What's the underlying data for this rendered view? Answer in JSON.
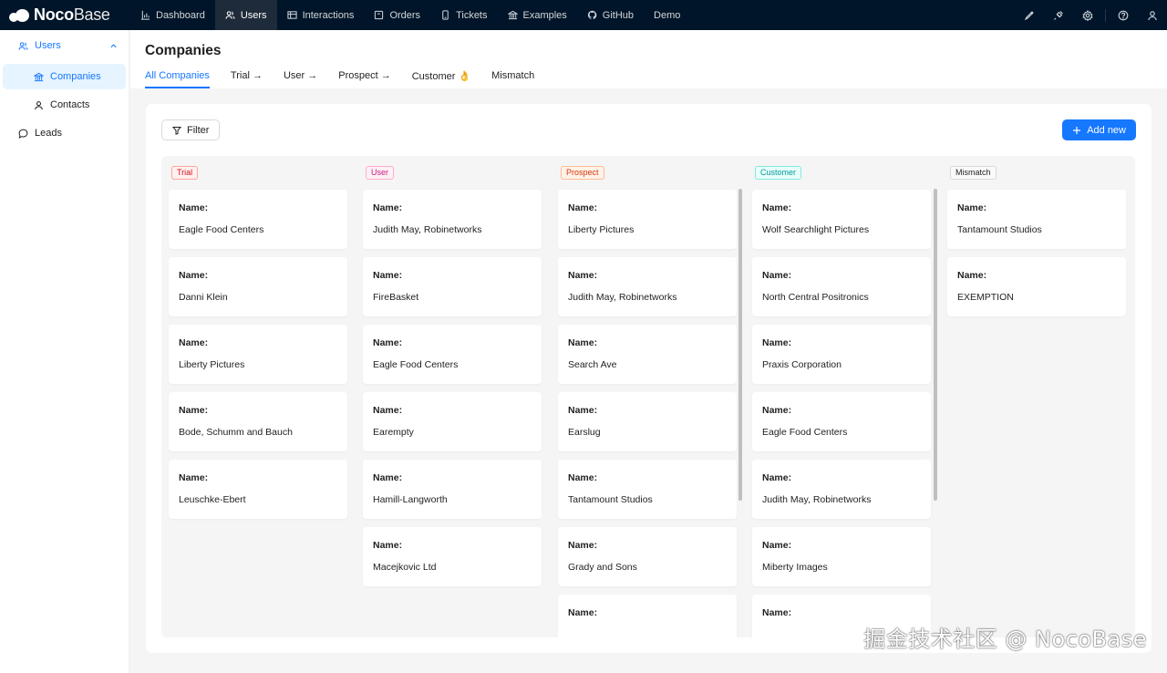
{
  "brand": {
    "name_bold": "Noco",
    "name_light": "Base"
  },
  "topnav": {
    "items": [
      {
        "label": "Dashboard",
        "icon": "bar-chart-icon"
      },
      {
        "label": "Users",
        "icon": "users-icon"
      },
      {
        "label": "Interactions",
        "icon": "table-icon"
      },
      {
        "label": "Orders",
        "icon": "box-icon"
      },
      {
        "label": "Tickets",
        "icon": "ticket-icon"
      },
      {
        "label": "Examples",
        "icon": "bank-icon"
      },
      {
        "label": "GitHub",
        "icon": "github-icon"
      },
      {
        "label": "Demo",
        "icon": ""
      }
    ],
    "active_index": 1,
    "right_icons": [
      "highlighter-icon",
      "plugin-icon",
      "settings-icon",
      "help-icon",
      "user-icon"
    ]
  },
  "sidebar": {
    "group_label": "Users",
    "items": [
      {
        "label": "Companies",
        "active": true
      },
      {
        "label": "Contacts",
        "active": false
      }
    ],
    "leads_label": "Leads"
  },
  "page": {
    "title": "Companies",
    "tabs": [
      "All Companies",
      "Trial →",
      "User →",
      "Prospect →",
      "Customer 👌",
      "Mismatch"
    ],
    "active_tab": 0
  },
  "toolbar": {
    "filter_label": "Filter",
    "add_label": "Add new"
  },
  "kanban": {
    "field_label": "Name",
    "columns": [
      {
        "tag": "Trial",
        "color": "#cf1322",
        "bg": "#fff1f0",
        "border": "#ffa39e",
        "cards": [
          "Eagle Food Centers",
          "Danni Klein",
          "Liberty Pictures",
          "Bode, Schumm and Bauch",
          "Leuschke-Ebert"
        ]
      },
      {
        "tag": "User",
        "color": "#c41d7f",
        "bg": "#fff0f6",
        "border": "#ffadd2",
        "cards": [
          "Judith May, Robinetworks",
          "FireBasket",
          "Eagle Food Centers",
          "Earempty",
          "Hamill-Langworth",
          "Macejkovic Ltd"
        ]
      },
      {
        "tag": "Prospect",
        "color": "#d4380d",
        "bg": "#fff2e8",
        "border": "#ffbb96",
        "cards": [
          "Liberty Pictures",
          "Judith May, Robinetworks",
          "Search Ave",
          "Earslug",
          "Tantamount Studios",
          "Grady and Sons",
          ""
        ]
      },
      {
        "tag": "Customer",
        "color": "#08979c",
        "bg": "#e6fffb",
        "border": "#87e8de",
        "cards": [
          "Wolf Searchlight Pictures",
          "North Central Positronics",
          "Praxis Corporation",
          "Eagle Food Centers",
          "Judith May, Robinetworks",
          "Miberty Images",
          ""
        ]
      },
      {
        "tag": "Mismatch",
        "color": "#1f1f1f",
        "bg": "#fafafa",
        "border": "#d9d9d9",
        "cards": [
          "Tantamount Studios",
          "EXEMPTION"
        ]
      }
    ]
  },
  "watermark": "掘金技术社区 @ NocoBase"
}
